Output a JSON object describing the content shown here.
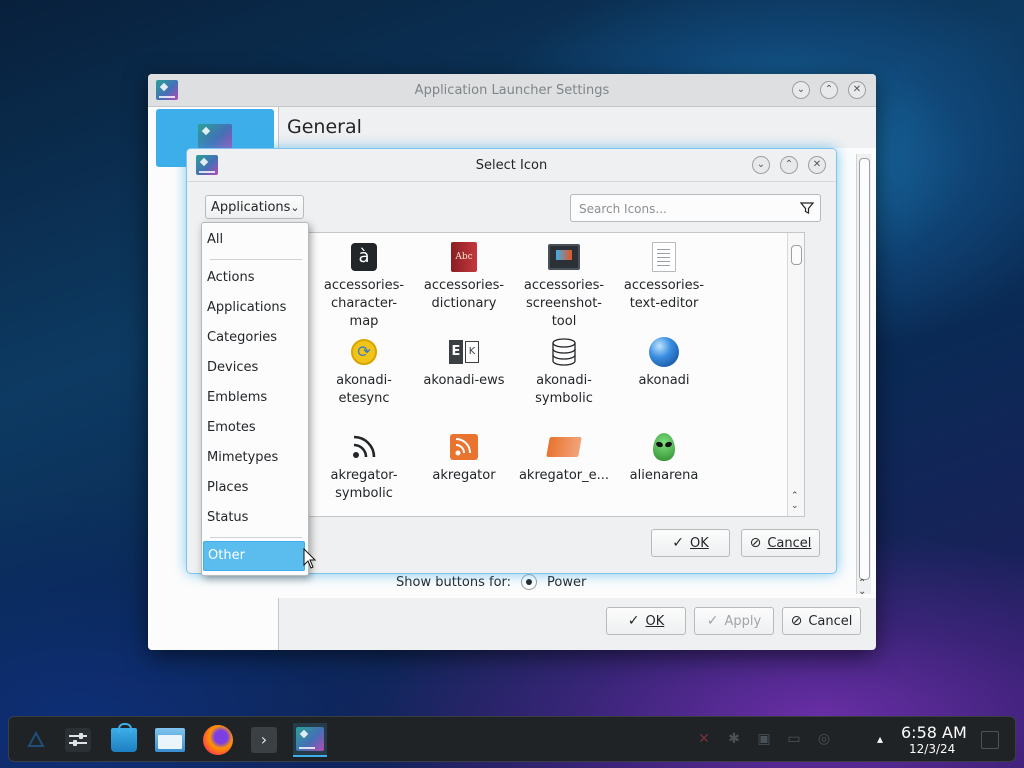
{
  "main_window": {
    "title": "Application Launcher Settings",
    "heading": "General",
    "show_buttons_label": "Show buttons for:",
    "show_buttons_value": "Power",
    "ok_label": "OK",
    "apply_label": "Apply",
    "cancel_label": "Cancel"
  },
  "dialog": {
    "title": "Select Icon",
    "combo_value": "Applications",
    "search_placeholder": "Search Icons...",
    "ok_label": "OK",
    "cancel_label": "Cancel",
    "icons": [
      {
        "label": "accessories-character-map",
        "line1": "accessories-",
        "line2": "character-",
        "line3": "map",
        "icon": "character-map-icon"
      },
      {
        "label": "accessories-dictionary",
        "line1": "accessories-",
        "line2": "dictionary",
        "line3": "",
        "icon": "dictionary-icon"
      },
      {
        "label": "accessories-screenshot-tool",
        "line1": "accessories-",
        "line2": "screenshot-",
        "line3": "tool",
        "icon": "screenshot-icon"
      },
      {
        "label": "accessories-text-editor",
        "line1": "accessories-",
        "line2": "text-editor",
        "line3": "",
        "icon": "text-editor-icon"
      },
      {
        "label": "akonadi-etesync",
        "line1": "akonadi-",
        "line2": "etesync",
        "line3": "",
        "icon": "etesync-icon"
      },
      {
        "label": "akonadi-ews",
        "line1": "akonadi-ews",
        "line2": "",
        "line3": "",
        "icon": "exchange-icon"
      },
      {
        "label": "akonadi-symbolic",
        "line1": "akonadi-",
        "line2": "symbolic",
        "line3": "",
        "icon": "database-icon"
      },
      {
        "label": "akonadi",
        "line1": "akonadi",
        "line2": "",
        "line3": "",
        "icon": "akonadi-sphere-icon"
      },
      {
        "label": "akregator-symbolic",
        "line1": "akregator-",
        "line2": "symbolic",
        "line3": "",
        "icon": "rss-symbolic-icon"
      },
      {
        "label": "akregator",
        "line1": "akregator",
        "line2": "",
        "line3": "",
        "icon": "rss-icon"
      },
      {
        "label": "akregator_e...",
        "line1": "akregator_e...",
        "line2": "",
        "line3": "",
        "icon": "akregator-empty-icon"
      },
      {
        "label": "alienarena",
        "line1": "alienarena",
        "line2": "",
        "line3": "",
        "icon": "alien-icon"
      }
    ]
  },
  "dropdown": {
    "items": [
      "All",
      "Actions",
      "Applications",
      "Categories",
      "Devices",
      "Emblems",
      "Emotes",
      "Mimetypes",
      "Places",
      "Status",
      "Other"
    ],
    "highlighted": "Other"
  },
  "taskbar": {
    "time": "6:58 AM",
    "date": "12/3/24",
    "apps": [
      "kde-menu-icon",
      "system-settings-icon",
      "discover-store-icon",
      "dolphin-files-icon",
      "firefox-icon",
      "konsole-icon",
      "app-launcher-settings-icon"
    ]
  },
  "colors": {
    "accent": "#3daee9",
    "window_bg": "#eff0f1",
    "view_bg": "#fcfcfc",
    "taskbar_bg": "#202326"
  }
}
